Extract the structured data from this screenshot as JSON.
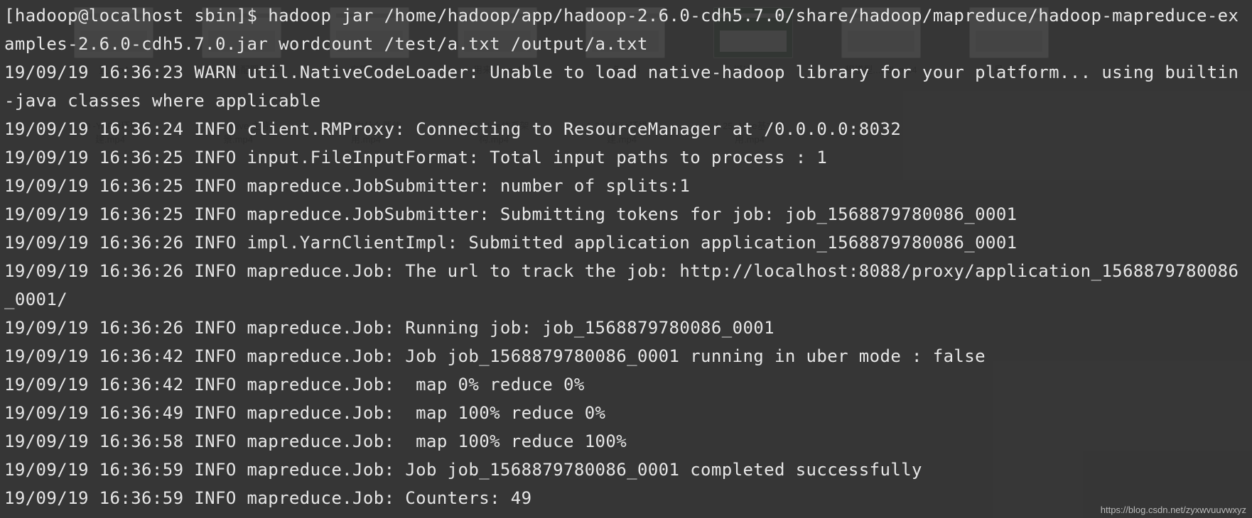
{
  "prompt_prefix": "[hadoop@localhost sbin]$ ",
  "command": "hadoop jar /home/hadoop/app/hadoop-2.6.0-cdh5.7.0/share/hadoop/mapreduce/hadoop-mapreduce-examples-2.6.0-cdh5.7.0.jar wordcount /test/a.txt /output/a.txt",
  "lines": [
    "19/09/19 16:36:23 WARN util.NativeCodeLoader: Unable to load native-hadoop library for your platform... using builtin-java classes where applicable",
    "19/09/19 16:36:24 INFO client.RMProxy: Connecting to ResourceManager at /0.0.0.0:8032",
    "19/09/19 16:36:25 INFO input.FileInputFormat: Total input paths to process : 1",
    "19/09/19 16:36:25 INFO mapreduce.JobSubmitter: number of splits:1",
    "19/09/19 16:36:25 INFO mapreduce.JobSubmitter: Submitting tokens for job: job_1568879780086_0001",
    "19/09/19 16:36:26 INFO impl.YarnClientImpl: Submitted application application_1568879780086_0001",
    "19/09/19 16:36:26 INFO mapreduce.Job: The url to track the job: http://localhost:8088/proxy/application_1568879780086_0001/",
    "19/09/19 16:36:26 INFO mapreduce.Job: Running job: job_1568879780086_0001",
    "19/09/19 16:36:42 INFO mapreduce.Job: Job job_1568879780086_0001 running in uber mode : false",
    "19/09/19 16:36:42 INFO mapreduce.Job:  map 0% reduce 0%",
    "19/09/19 16:36:49 INFO mapreduce.Job:  map 100% reduce 0%",
    "19/09/19 16:36:58 INFO mapreduce.Job:  map 100% reduce 100%",
    "19/09/19 16:36:59 INFO mapreduce.Job: Job job_1568879780086_0001 completed successfully",
    "19/09/19 16:36:59 INFO mapreduce.Job: Counters: 49"
  ],
  "bg_row1": [
    "置.mp4",
    "文件与备配置.mp4",
    "启停.mp4",
    "用来作.mp4",
    "点.mp4",
    "概述.mp4",
    "程模型...Sdk.mp4",
    "景.mp4"
  ],
  "bg_row2": [
    "1-20 -YARN环境搭",
    "1-21 -Hive 主背",
    "1-22 -为什么要使",
    "1-23 -Hive体系架",
    "1-24 -Hive环境搭",
    "1-25 -Hive基本使"
  ],
  "bg_row2b": [
    "建.mp4",
    "景.mp4",
    "用.mp4",
    "构.mp4",
    "建.mp4",
    "用.mp4"
  ],
  "watermark": "https://blog.csdn.net/zyxwvuuvwxyz"
}
